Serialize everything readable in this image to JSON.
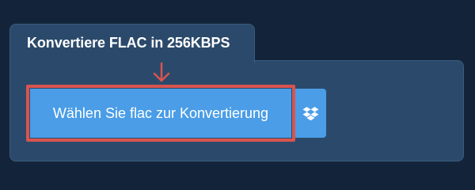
{
  "converter": {
    "tab_title": "Konvertiere FLAC in 256KBPS",
    "choose_file_label": "Wählen Sie flac zur Konvertierung",
    "dropbox_icon": "dropbox-icon",
    "pointer_icon": "arrow-down-icon"
  },
  "colors": {
    "page_background": "#13243a",
    "panel_background": "#2b4a6b",
    "button_background": "#4a9de6",
    "highlight_border": "#d9544f",
    "text": "#ffffff"
  }
}
